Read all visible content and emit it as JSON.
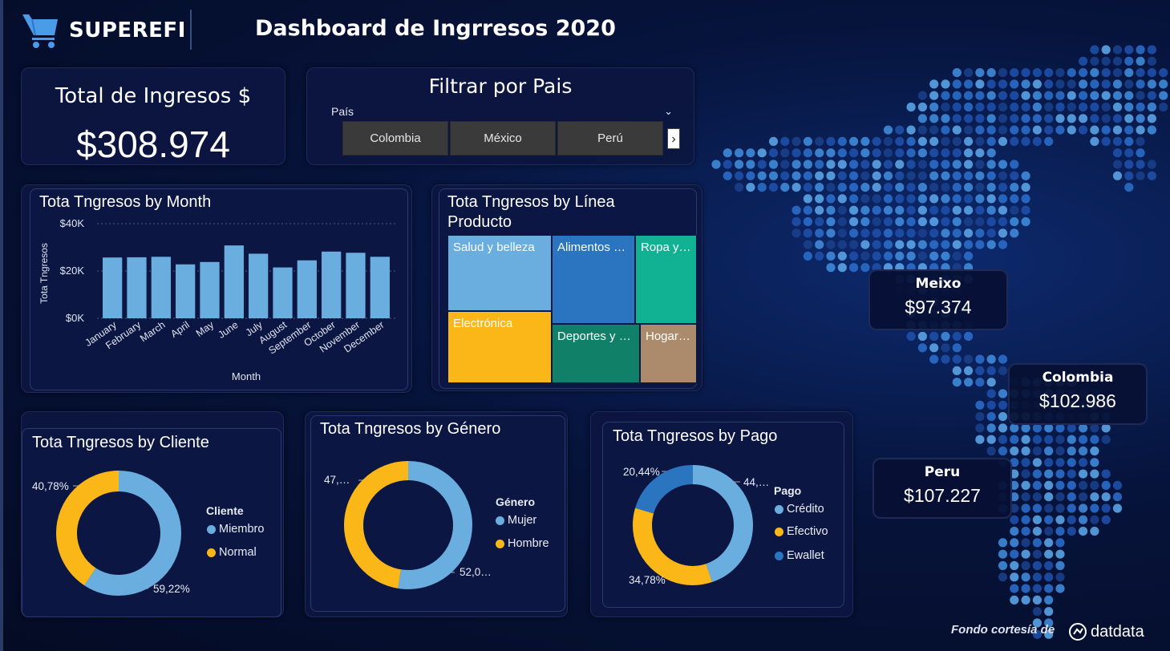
{
  "header": {
    "brand": "SUPEREFI",
    "title": "Dashboard de Ingrresos 2020"
  },
  "kpi": {
    "title": "Total de Ingresos $",
    "value": "$308.974"
  },
  "filter": {
    "title": "Filtrar por Pais",
    "field_label": "País",
    "options": [
      "Colombia",
      "México",
      "Perú"
    ]
  },
  "charts": {
    "month": {
      "title": "Tota Tngresos by Month",
      "xlabel": "Month",
      "ylabel": "Tota Tngresos",
      "ticks": [
        "$40K",
        "$20K",
        "$0K"
      ]
    },
    "linea": {
      "title": "Tota Tngresos by Línea Producto",
      "items": [
        "Salud y belleza",
        "Alimentos …",
        "Ropa y…",
        "Electrónica",
        "Deportes y …",
        "Hogar…"
      ]
    },
    "cliente": {
      "title": "Tota Tngresos by Cliente",
      "legend_title": "Cliente",
      "legend": [
        "Miembro",
        "Normal"
      ],
      "labels": [
        "59,22%",
        "40,78%"
      ]
    },
    "genero": {
      "title": "Tota Tngresos by Género",
      "legend_title": "Género",
      "legend": [
        "Mujer",
        "Hombre"
      ],
      "labels": [
        "52,0…",
        "47,…"
      ]
    },
    "pago": {
      "title": "Tota Tngresos by Pago",
      "legend_title": "Pago",
      "legend": [
        "Crédito",
        "Efectivo",
        "Ewallet"
      ],
      "labels": [
        "44,…",
        "34,78%",
        "20,44%"
      ]
    }
  },
  "map_cards": {
    "mexico": {
      "name": "Meixo",
      "value": "$97.374"
    },
    "colombia": {
      "name": "Colombia",
      "value": "$102.986"
    },
    "peru": {
      "name": "Peru",
      "value": "$107.227"
    }
  },
  "footer": {
    "text": "Fondo cortesía de",
    "brand": "datdata"
  },
  "colors": {
    "bar": "#6aaee0",
    "light_blue": "#6aaee0",
    "yellow": "#fbb718",
    "mid_blue": "#2a74c0",
    "teal": "#11b294",
    "dark_teal": "#118068",
    "tan": "#ab8b6c",
    "background": "#06133a"
  },
  "chart_data": [
    {
      "type": "bar",
      "title": "Tota Tngresos by Month",
      "xlabel": "Month",
      "ylabel": "Tota Tngresos",
      "categories": [
        "January",
        "February",
        "March",
        "April",
        "May",
        "June",
        "July",
        "August",
        "September",
        "October",
        "November",
        "December"
      ],
      "values": [
        25700,
        25800,
        26000,
        22800,
        23800,
        30800,
        27300,
        21500,
        24500,
        28200,
        27700,
        26000
      ],
      "ylim": [
        0,
        40000
      ]
    },
    {
      "type": "treemap",
      "title": "Tota Tngresos by Línea Producto",
      "categories": [
        "Salud y belleza",
        "Alimentos …",
        "Ropa y…",
        "Electrónica",
        "Deportes y …",
        "Hogar…"
      ]
    },
    {
      "type": "pie",
      "title": "Tota Tngresos by Cliente",
      "categories": [
        "Miembro",
        "Normal"
      ],
      "values": [
        59.22,
        40.78
      ]
    },
    {
      "type": "pie",
      "title": "Tota Tngresos by Género",
      "categories": [
        "Mujer",
        "Hombre"
      ],
      "values": [
        52.0,
        47.0
      ]
    },
    {
      "type": "pie",
      "title": "Tota Tngresos by Pago",
      "categories": [
        "Crédito",
        "Efectivo",
        "Ewallet"
      ],
      "values": [
        44.78,
        34.78,
        20.44
      ]
    }
  ]
}
